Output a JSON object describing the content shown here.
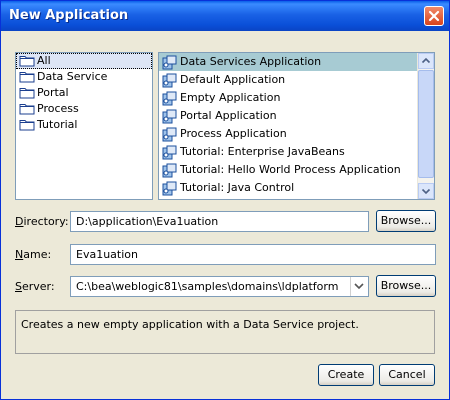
{
  "window": {
    "title": "New Application"
  },
  "categories": [
    {
      "label": "All",
      "selected": true
    },
    {
      "label": "Data Service"
    },
    {
      "label": "Portal"
    },
    {
      "label": "Process"
    },
    {
      "label": "Tutorial"
    }
  ],
  "templates": [
    {
      "label": "Data Services Application",
      "selected": true
    },
    {
      "label": "Default Application"
    },
    {
      "label": "Empty Application"
    },
    {
      "label": "Portal Application"
    },
    {
      "label": "Process Application"
    },
    {
      "label": "Tutorial: Enterprise JavaBeans"
    },
    {
      "label": "Tutorial: Hello World Process Application"
    },
    {
      "label": "Tutorial: Java Control"
    }
  ],
  "directory": {
    "label_pre": "",
    "label_u": "D",
    "label_post": "irectory:",
    "value": "D:\\application\\Eva1uation",
    "browse_label": "Browse..."
  },
  "name": {
    "label_pre": "",
    "label_u": "N",
    "label_post": "ame:",
    "value": "Eva1uation"
  },
  "server": {
    "label_pre": "",
    "label_u": "S",
    "label_post": "erver:",
    "value": "C:\\bea\\weblogic81\\samples\\domains\\ldplatform",
    "browse_label": "Browse..."
  },
  "description": "Creates a new empty application with a Data Service project.",
  "buttons": {
    "create": "Create",
    "cancel": "Cancel"
  },
  "colors": {
    "title_bar": "#0a5fe8",
    "selection": "#a7cbd3",
    "dialog_bg": "#ece9d8"
  }
}
